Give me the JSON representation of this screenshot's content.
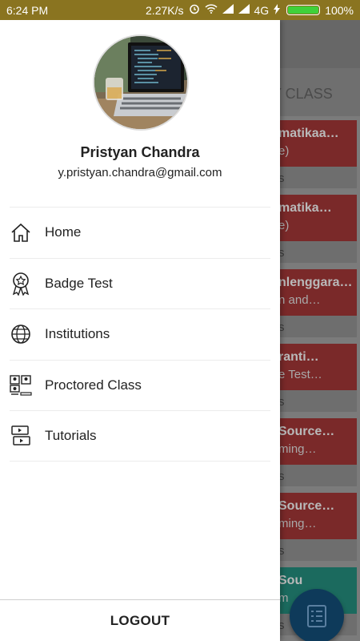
{
  "status_bar": {
    "time": "6:24 PM",
    "network_speed": "2.27K/s",
    "network_type": "4G",
    "battery_percent": "100%",
    "battery_level": 1.0,
    "icons": [
      "alarm-icon",
      "wifi-icon",
      "signal-icon",
      "signal-icon",
      "charging-icon"
    ]
  },
  "drawer": {
    "profile": {
      "name": "Pristyan Chandra",
      "email": "y.pristyan.chandra@gmail.com"
    },
    "menu": [
      {
        "label": "Home",
        "icon": "home-icon"
      },
      {
        "label": "Badge Test",
        "icon": "badge-icon"
      },
      {
        "label": "Institutions",
        "icon": "globe-icon"
      },
      {
        "label": "Proctored Class",
        "icon": "proctored-class-icon"
      },
      {
        "label": "Tutorials",
        "icon": "tutorial-video-icon"
      }
    ],
    "logout_label": "LOGOUT"
  },
  "background": {
    "tab_label": "Y CLASS",
    "cards": [
      {
        "title": "matikaa…",
        "subtitle": "e)",
        "footer": "s"
      },
      {
        "title": "matika…",
        "subtitle": "e)",
        "footer": "s"
      },
      {
        "title": "nlenggara…",
        "subtitle": "n and…",
        "footer": "s"
      },
      {
        "title": "ranti…",
        "subtitle": "e Test…",
        "footer": "s"
      },
      {
        "title": "Source…",
        "subtitle": "ming…",
        "footer": "s"
      },
      {
        "title": "Source…",
        "subtitle": "ming…",
        "footer": "s"
      },
      {
        "title": "Sou",
        "subtitle": "m",
        "footer": "s"
      }
    ],
    "fab_icon": "checklist-icon"
  },
  "colors": {
    "status_bar": "#8a7420",
    "battery_fill": "#3fd13a",
    "card_red": "#7a2929",
    "card_teal": "#1b6a5e",
    "fab": "#0e3a5a"
  }
}
